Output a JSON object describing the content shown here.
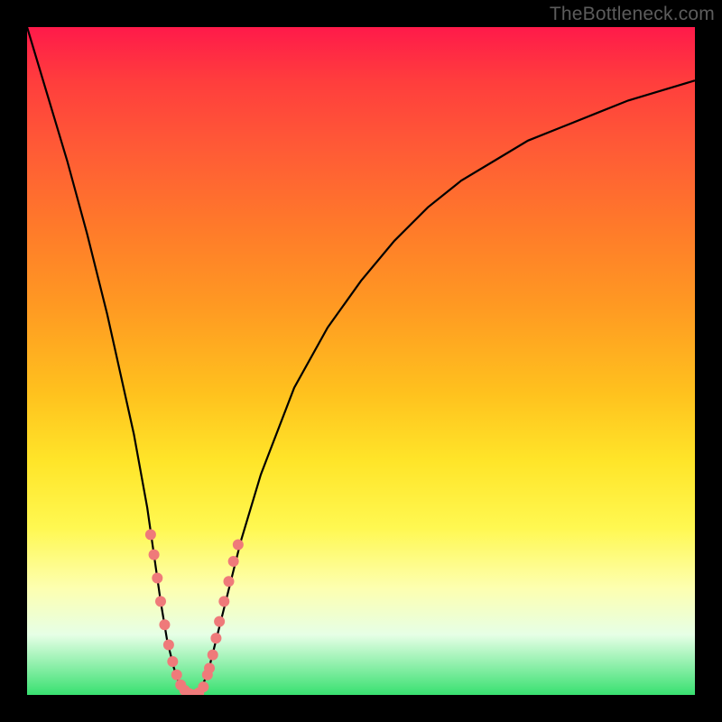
{
  "watermark": "TheBottleneck.com",
  "colors": {
    "background": "#000000",
    "gradient_top": "#ff1a4a",
    "gradient_bottom": "#38e070",
    "curve": "#000000",
    "markers": "#ef7a7a"
  },
  "chart_data": {
    "type": "line",
    "title": "",
    "xlabel": "",
    "ylabel": "",
    "xlim": [
      0,
      100
    ],
    "ylim": [
      0,
      100
    ],
    "x": [
      0,
      3,
      6,
      9,
      12,
      14,
      16,
      18,
      19,
      20,
      21,
      22,
      23,
      24,
      25,
      26,
      27,
      28,
      30,
      32,
      35,
      40,
      45,
      50,
      55,
      60,
      65,
      70,
      75,
      80,
      85,
      90,
      95,
      100
    ],
    "y": [
      100,
      90,
      80,
      69,
      57,
      48,
      39,
      28,
      21,
      14,
      8,
      4,
      1,
      0,
      0,
      1,
      3,
      7,
      15,
      23,
      33,
      46,
      55,
      62,
      68,
      73,
      77,
      80,
      83,
      85,
      87,
      89,
      90.5,
      92
    ],
    "minimum_x": 24,
    "markers": {
      "x": [
        18.5,
        19.0,
        19.5,
        20.0,
        20.6,
        21.2,
        21.8,
        22.4,
        23.0,
        23.6,
        24.3,
        25.0,
        25.7,
        26.4,
        27.0,
        27.3,
        27.8,
        28.3,
        28.8,
        29.5,
        30.2,
        30.9,
        31.6
      ],
      "y": [
        24.0,
        21.0,
        17.5,
        14.0,
        10.5,
        7.5,
        5.0,
        3.0,
        1.5,
        0.7,
        0.2,
        0.0,
        0.3,
        1.2,
        3.0,
        4.0,
        6.0,
        8.5,
        11.0,
        14.0,
        17.0,
        20.0,
        22.5
      ]
    }
  }
}
